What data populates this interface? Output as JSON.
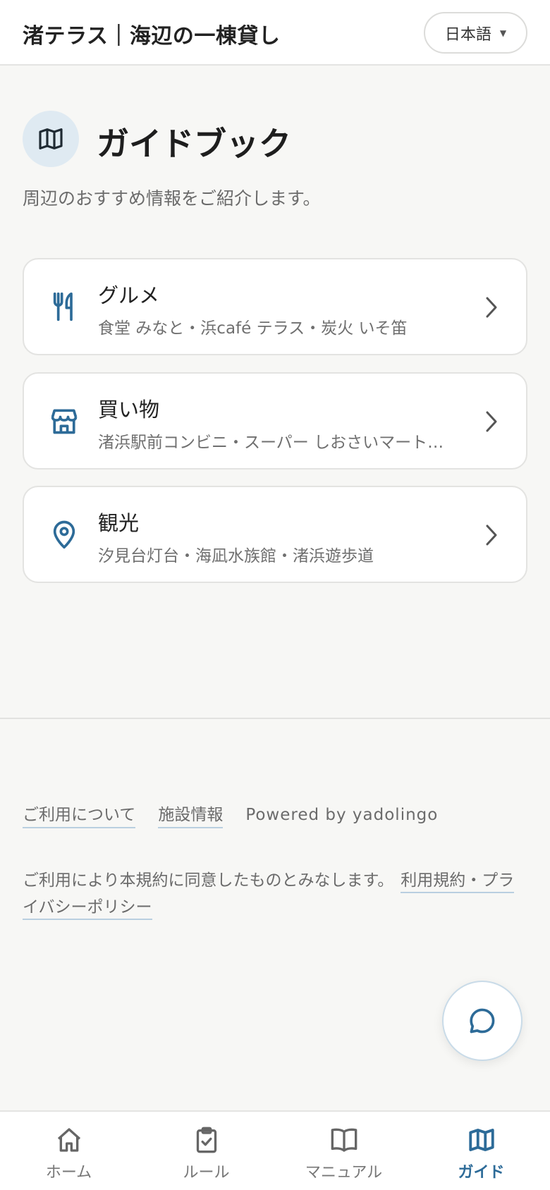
{
  "header": {
    "title": "渚テラス｜海辺の一棟貸し",
    "language": "日本語"
  },
  "page": {
    "icon": "map-icon",
    "title": "ガイドブック",
    "subtitle": "周辺のおすすめ情報をご紹介します。"
  },
  "categories": [
    {
      "icon": "fork-knife-icon",
      "title": "グルメ",
      "desc": "食堂 みなと・浜café テラス・炭火 いそ笛"
    },
    {
      "icon": "store-icon",
      "title": "買い物",
      "desc": "渚浜駅前コンビニ・スーパー しおさいマート…"
    },
    {
      "icon": "map-pin-icon",
      "title": "観光",
      "desc": "汐見台灯台・海凪水族館・渚浜遊歩道"
    }
  ],
  "footer": {
    "links": [
      "ご利用について",
      "施設情報"
    ],
    "powered": "Powered by yadolingo",
    "note": "ご利用により本規約に同意したものとみなします。",
    "terms_link": "利用規約・プライバシーポリシー"
  },
  "chat": {
    "icon": "chat-bubble-icon"
  },
  "nav": {
    "items": [
      {
        "label": "ホーム",
        "icon": "home-icon",
        "active": false
      },
      {
        "label": "ルール",
        "icon": "clipboard-check-icon",
        "active": false
      },
      {
        "label": "マニュアル",
        "icon": "book-icon",
        "active": false
      },
      {
        "label": "ガイド",
        "icon": "map-icon",
        "active": true
      }
    ]
  },
  "colors": {
    "accent": "#2d6b98",
    "background": "#f7f7f5",
    "icon_circle": "#dfeaf2"
  }
}
